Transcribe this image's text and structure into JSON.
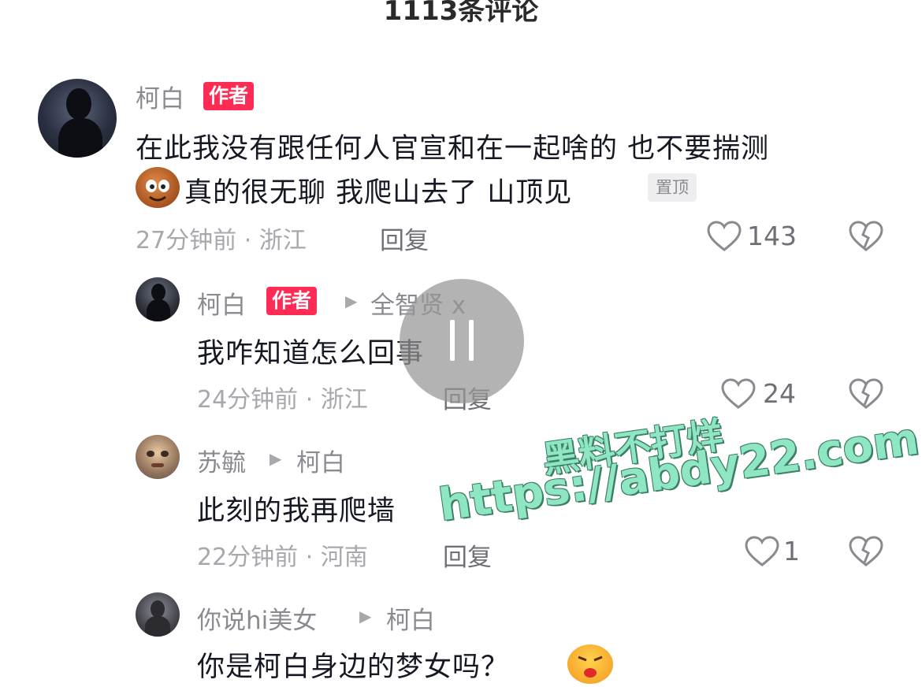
{
  "header": {
    "title": "1113条评论"
  },
  "comments": [
    {
      "user": "柯白",
      "badge": "作者",
      "text_line1": "在此我没有跟任何人官宣和在一起啥的 也不要揣测",
      "text_line2": "真的很无聊 我爬山去了 山顶见",
      "pinned": "置顶",
      "meta": "27分钟前 · 浙江",
      "reply": "回复",
      "likes": "143"
    },
    {
      "user": "柯白",
      "badge": "作者",
      "reply_to": "全智贤 x",
      "text": "我咋知道怎么回事",
      "meta": "24分钟前 · 浙江",
      "reply": "回复",
      "likes": "24"
    },
    {
      "user": "苏毓",
      "reply_to": "柯白",
      "text": "此刻的我再爬墙",
      "meta": "22分钟前 · 河南",
      "reply": "回复",
      "likes": "1"
    },
    {
      "user": "你说hi美女",
      "reply_to": "柯白",
      "text": "你是柯白身边的梦女吗？"
    }
  ],
  "watermark": {
    "line1": "黑料不打烊",
    "line2": "https://abdy22.com"
  },
  "icons": {
    "like": "heart-outline-icon",
    "dislike": "broken-heart-icon",
    "pause": "pause-icon",
    "reply_arrow": "triangle-right-icon"
  },
  "colors": {
    "badge": "#fe2c55",
    "watermark": "#8fe6c3"
  }
}
